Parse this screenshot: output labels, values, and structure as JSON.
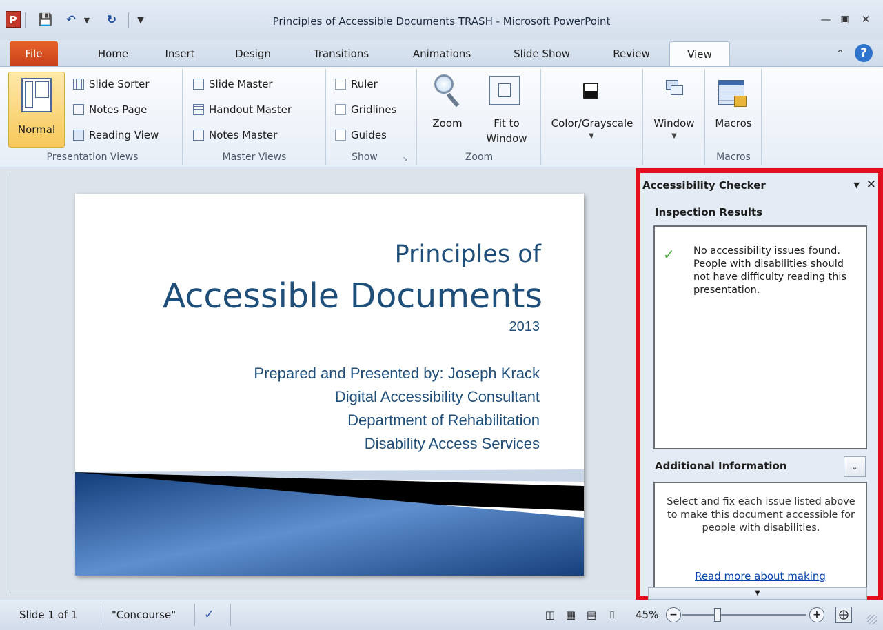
{
  "window": {
    "title": "Principles of Accessible Documents TRASH  -  Microsoft PowerPoint",
    "qat_icons": [
      "powerpoint-logo-icon",
      "save-icon",
      "undo-icon",
      "redo-icon",
      "customize-qat-icon"
    ]
  },
  "tabs": [
    "File",
    "Home",
    "Insert",
    "Design",
    "Transitions",
    "Animations",
    "Slide Show",
    "Review",
    "View"
  ],
  "active_tab": "View",
  "ribbon": {
    "presentation_views": {
      "label": "Presentation Views",
      "normal": "Normal",
      "slide_sorter": "Slide Sorter",
      "notes_page": "Notes Page",
      "reading_view": "Reading View"
    },
    "master_views": {
      "label": "Master Views",
      "slide_master": "Slide Master",
      "handout_master": "Handout Master",
      "notes_master": "Notes Master"
    },
    "show": {
      "label": "Show",
      "ruler": "Ruler",
      "gridlines": "Gridlines",
      "guides": "Guides"
    },
    "zoom": {
      "label": "Zoom",
      "zoom": "Zoom",
      "fit_line1": "Fit to",
      "fit_line2": "Window"
    },
    "color": {
      "label": "Color/Grayscale"
    },
    "window": {
      "label": "Window"
    },
    "macros": {
      "label": "Macros",
      "button": "Macros"
    }
  },
  "slide": {
    "title_line1": "Principles of",
    "title_line2": "Accessible Documents",
    "year": "2013",
    "sub1": "Prepared and Presented by: Joseph  Krack",
    "sub2": "Digital Accessibility Consultant",
    "sub3": "Department of Rehabilitation",
    "sub4": "Disability Access Services"
  },
  "pane": {
    "title": "Accessibility Checker",
    "results_heading": "Inspection Results",
    "result_message": "No accessibility issues found. People with disabilities should not have difficulty reading this presentation.",
    "info_heading": "Additional Information",
    "info_text": "Select and fix each issue listed above to make this document accessible for people with disabilities.",
    "info_link": "Read more about making"
  },
  "status": {
    "slide": "Slide 1 of 1",
    "theme": "\"Concourse\"",
    "zoom": "45%"
  },
  "colors": {
    "accent_red": "#e2101e",
    "file_tab": "#d04a1f",
    "slide_title": "#1f4e79",
    "check_green": "#4caf3c",
    "link": "#0645ad"
  }
}
